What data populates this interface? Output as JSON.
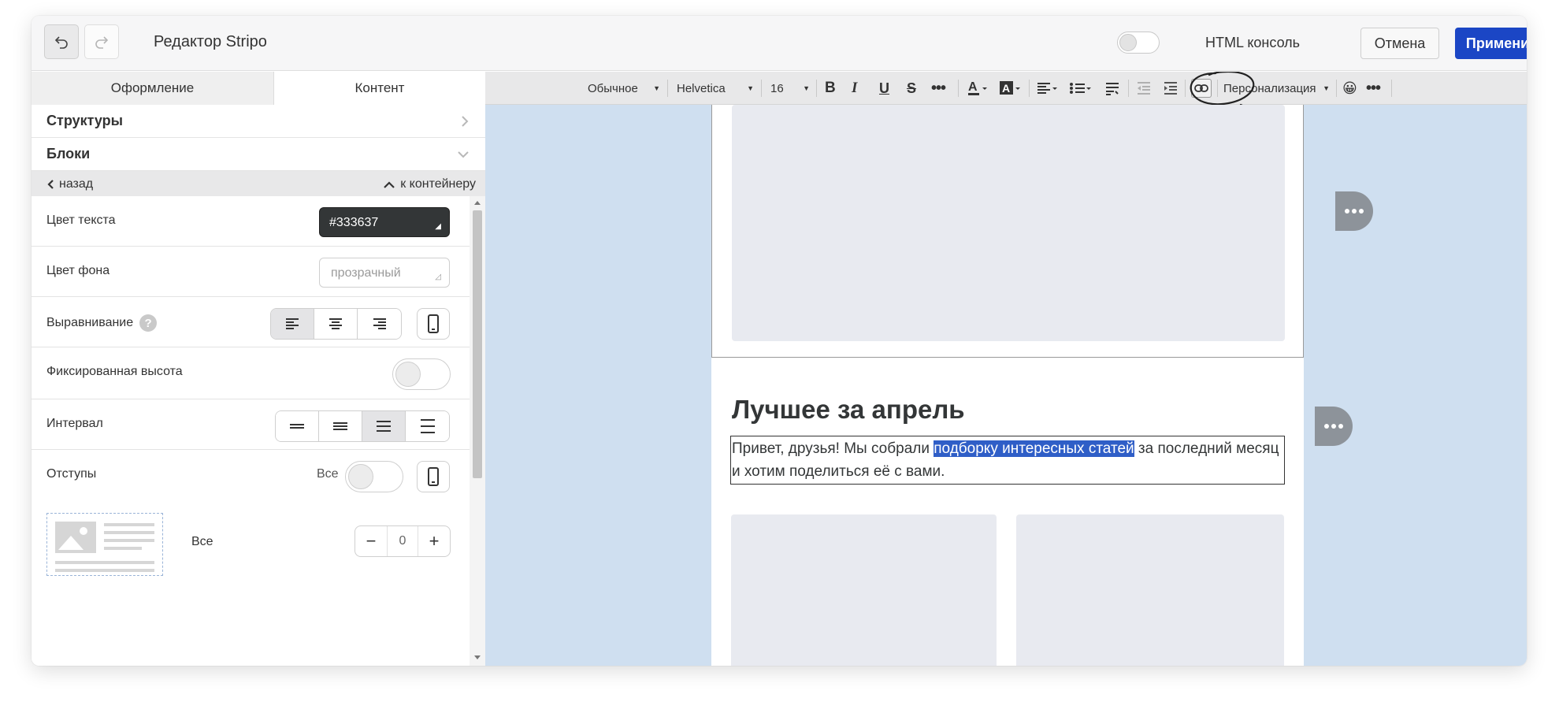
{
  "header": {
    "title": "Редактор Stripo",
    "html_console_label": "HTML консоль",
    "cancel_label": "Отмена",
    "apply_label": "Применить",
    "html_console_on": false
  },
  "left_panel": {
    "tabs": [
      {
        "label": "Оформление",
        "active": false
      },
      {
        "label": "Контент",
        "active": true
      }
    ],
    "sections": {
      "structures": "Структуры",
      "blocks": "Блоки"
    },
    "nav": {
      "back": "назад",
      "to_container": "к контейнеру"
    },
    "props": {
      "text_color_label": "Цвет текста",
      "text_color_value": "#333637",
      "bg_color_label": "Цвет фона",
      "bg_color_value": "прозрачный",
      "align_label": "Выравнивание",
      "align_help": "?",
      "fixed_height_label": "Фиксированная высота",
      "fixed_height_on": false,
      "interval_label": "Интервал",
      "padding_label": "Отступы",
      "padding_all_label": "Все",
      "padding_all_row_label": "Все",
      "padding_value": "0"
    }
  },
  "toolbar": {
    "style": "Обычное",
    "font": "Helvetica",
    "size": "16",
    "personalization": "Персонализация"
  },
  "email": {
    "heading": "Лучшее за апрель",
    "para_before": "Привет, друзья! Мы собрали ",
    "para_highlight": "подборку интересных статей",
    "para_after": " за последний месяц и хотим поделиться её с вами."
  },
  "colors": {
    "accent": "#1b46c5",
    "canvas_bg": "#cfdff0",
    "selection": "#2f5ec7",
    "text": "#333637"
  }
}
